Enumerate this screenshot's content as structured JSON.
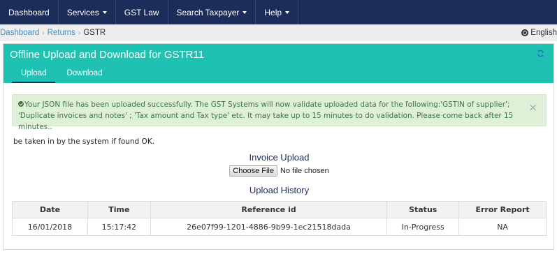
{
  "nav": {
    "items": [
      {
        "label": "Dashboard",
        "dropdown": false
      },
      {
        "label": "Services",
        "dropdown": true
      },
      {
        "label": "GST Law",
        "dropdown": false
      },
      {
        "label": "Search Taxpayer",
        "dropdown": true
      },
      {
        "label": "Help",
        "dropdown": true
      }
    ]
  },
  "breadcrumb": {
    "items": [
      "Dashboard",
      "Returns"
    ],
    "current": "GSTR",
    "language": "English"
  },
  "panel": {
    "title": "Offline Upload and Download for GSTR11",
    "tabs": [
      "Upload",
      "Download"
    ],
    "active_tab": "Upload"
  },
  "alert": {
    "text": "Your JSON file has been uploaded successfully. The GST Systems will now validate uploaded data for the following:'GSTIN of supplier'; 'Duplicate invoices and notes' ; 'Tax amount and Tax type' etc. It may take up to 15 minutes to do validation. Please come back after 15 minutes..",
    "close": "×"
  },
  "note": "be taken in by the system if found OK.",
  "invoice_upload": {
    "title": "Invoice Upload",
    "button": "Choose File",
    "status": "No file chosen"
  },
  "history": {
    "title": "Upload History",
    "columns": [
      "Date",
      "Time",
      "Reference id",
      "Status",
      "Error Report"
    ],
    "rows": [
      [
        "16/01/2018",
        "15:17:42",
        "26e07f99-1201-4886-9b99-1ec21518dada",
        "In-Progress",
        "NA"
      ]
    ]
  },
  "colors": {
    "navbar": "#1d2d5a",
    "panel_header": "#1fc1b2",
    "alert_bg": "#dff0d8",
    "alert_text": "#3c763d",
    "link": "#3d8ec9"
  }
}
